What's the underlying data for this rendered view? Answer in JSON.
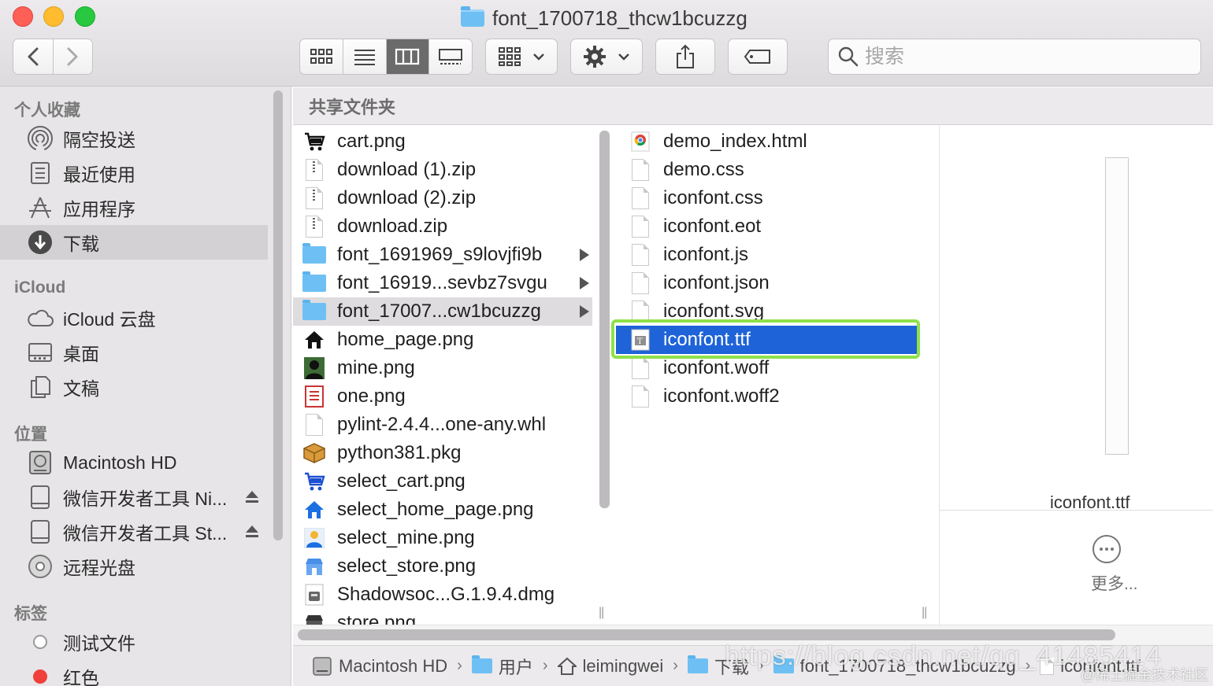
{
  "window": {
    "title": "font_1700718_thcw1bcuzzg"
  },
  "toolbar": {
    "search_placeholder": "搜索",
    "view_modes": [
      "icon-view",
      "list-view",
      "column-view",
      "gallery-view"
    ],
    "active_view": "column-view"
  },
  "sidebar": {
    "sections": {
      "favorites": "个人收藏",
      "icloud": "iCloud",
      "locations": "位置",
      "tags": "标签"
    },
    "favorites": [
      {
        "label": "隔空投送",
        "icon": "airdrop-icon"
      },
      {
        "label": "最近使用",
        "icon": "recents-icon"
      },
      {
        "label": "应用程序",
        "icon": "applications-icon"
      },
      {
        "label": "下载",
        "icon": "downloads-icon",
        "selected": true
      }
    ],
    "icloud": [
      {
        "label": "iCloud 云盘",
        "icon": "cloud-icon"
      },
      {
        "label": "桌面",
        "icon": "desktop-icon"
      },
      {
        "label": "文稿",
        "icon": "documents-icon"
      }
    ],
    "locations": [
      {
        "label": "Macintosh HD",
        "icon": "harddisk-icon"
      },
      {
        "label": "微信开发者工具 Ni...",
        "icon": "disk-image-icon",
        "eject": true
      },
      {
        "label": "微信开发者工具 St...",
        "icon": "disk-image-icon",
        "eject": true
      },
      {
        "label": "远程光盘",
        "icon": "remote-disc-icon"
      }
    ],
    "tags": [
      {
        "label": "测试文件",
        "color": "#ffffff"
      },
      {
        "label": "红色",
        "color": "#f0403c"
      }
    ]
  },
  "browser": {
    "header": "共享文件夹",
    "column1": [
      {
        "name": "cart.png",
        "icon": "cart-icon"
      },
      {
        "name": "download (1).zip",
        "icon": "zip-icon"
      },
      {
        "name": "download (2).zip",
        "icon": "zip-icon"
      },
      {
        "name": "download.zip",
        "icon": "zip-icon"
      },
      {
        "name": "font_1691969_s9lovjfi9b",
        "icon": "folder-icon",
        "folder": true
      },
      {
        "name": "font_16919...sevbz7svgu",
        "icon": "folder-icon",
        "folder": true
      },
      {
        "name": "font_17007...cw1bcuzzg",
        "icon": "folder-icon",
        "folder": true,
        "highlighted": true
      },
      {
        "name": "home_page.png",
        "icon": "home-icon"
      },
      {
        "name": "mine.png",
        "icon": "person-icon"
      },
      {
        "name": "one.png",
        "icon": "image-file-icon"
      },
      {
        "name": "pylint-2.4.4...one-any.whl",
        "icon": "document-icon"
      },
      {
        "name": "python381.pkg",
        "icon": "package-icon"
      },
      {
        "name": "select_cart.png",
        "icon": "cart-blue-icon"
      },
      {
        "name": "select_home_page.png",
        "icon": "home-blue-icon"
      },
      {
        "name": "select_mine.png",
        "icon": "person-blue-icon"
      },
      {
        "name": "select_store.png",
        "icon": "store-blue-icon"
      },
      {
        "name": "Shadowsoc...G.1.9.4.dmg",
        "icon": "dmg-icon"
      },
      {
        "name": "store.png",
        "icon": "store-icon"
      }
    ],
    "column2": [
      {
        "name": "demo_index.html",
        "icon": "chrome-html-icon"
      },
      {
        "name": "demo.css",
        "icon": "document-icon"
      },
      {
        "name": "iconfont.css",
        "icon": "document-icon"
      },
      {
        "name": "iconfont.eot",
        "icon": "document-icon"
      },
      {
        "name": "iconfont.js",
        "icon": "document-icon"
      },
      {
        "name": "iconfont.json",
        "icon": "document-icon"
      },
      {
        "name": "iconfont.svg",
        "icon": "document-icon"
      },
      {
        "name": "iconfont.ttf",
        "icon": "font-file-icon",
        "selected": true
      },
      {
        "name": "iconfont.woff",
        "icon": "document-icon"
      },
      {
        "name": "iconfont.woff2",
        "icon": "document-icon"
      }
    ]
  },
  "preview": {
    "file_name": "iconfont.ttf",
    "more_label": "更多..."
  },
  "pathbar": [
    {
      "label": "Macintosh HD",
      "icon": "harddisk-icon"
    },
    {
      "label": "用户",
      "icon": "folder-icon"
    },
    {
      "label": "leimingwei",
      "icon": "home-icon"
    },
    {
      "label": "下载",
      "icon": "downloads-folder-icon"
    },
    {
      "label": "font_1700718_thcw1bcuzzg",
      "icon": "folder-icon"
    },
    {
      "label": "iconfont.ttf",
      "icon": "font-file-icon"
    }
  ],
  "watermark": {
    "url": "https://blog.csdn.net/qq_41485414",
    "credit": "@稀土掘金技术社区"
  },
  "colors": {
    "selection": "#1e63d8",
    "highlight_ring": "#8fe14a",
    "folder": "#6ec0f4",
    "tag_red": "#f0403c"
  }
}
